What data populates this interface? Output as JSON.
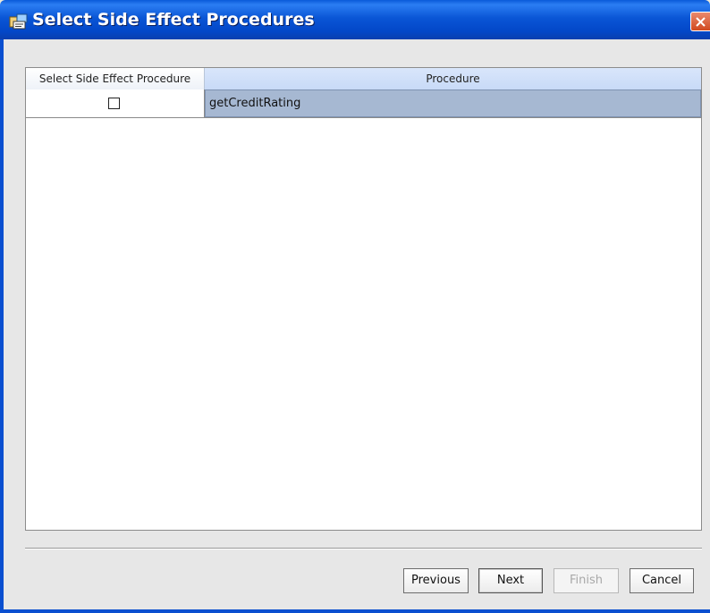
{
  "window": {
    "title": "Select Side Effect Procedures"
  },
  "table": {
    "columns": [
      "Select Side Effect Procedure",
      "Procedure"
    ],
    "rows": [
      {
        "selected": false,
        "procedure": "getCreditRating"
      }
    ]
  },
  "buttons": {
    "previous": "Previous",
    "next": "Next",
    "finish": "Finish",
    "cancel": "Cancel",
    "finish_enabled": false
  },
  "icons": {
    "app": "wizard-app-icon",
    "close": "close-icon"
  },
  "colors": {
    "titlebar": "#0a56d6",
    "selected_row": "#a6b8d2",
    "header_highlight": "#c8daf7"
  }
}
